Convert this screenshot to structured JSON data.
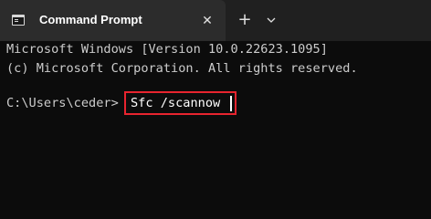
{
  "tab": {
    "title": "Command Prompt",
    "icon": "terminal-icon",
    "close_glyph": "✕"
  },
  "toolbar": {
    "new_tab_glyph": "+",
    "dropdown_icon": "chevron-down-icon"
  },
  "terminal": {
    "lines": [
      "Microsoft Windows [Version 10.0.22623.1095]",
      "(c) Microsoft Corporation. All rights reserved."
    ],
    "prompt": "C:\\Users\\ceder>",
    "command": "Sfc /scannow",
    "highlight_color": "#e8242f"
  }
}
